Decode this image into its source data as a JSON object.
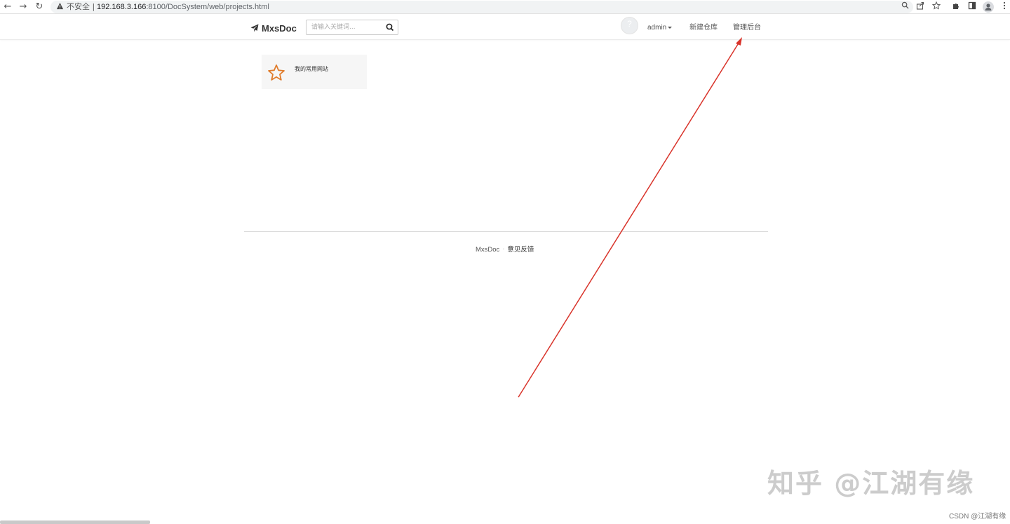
{
  "browser": {
    "back_glyph": "←",
    "forward_glyph": "→",
    "reload_glyph": "↻",
    "security_label": "不安全",
    "separator": "|",
    "url_host": "192.168.3.166",
    "url_rest": ":8100/DocSystem/web/projects.html",
    "icons": [
      "zoom-icon",
      "share-icon",
      "bookmark-star-icon",
      "extensions-icon",
      "side-panel-icon",
      "profile-icon",
      "more-menu-icon"
    ]
  },
  "header": {
    "brand_name": "MxsDoc",
    "search_placeholder": "请输入关键词...",
    "avatar_glyph": "?",
    "user_label": "admin",
    "nav": {
      "new_repo": "新建仓库",
      "admin_console": "管理后台"
    }
  },
  "main": {
    "projects": [
      {
        "title": "我的常用网站"
      }
    ]
  },
  "footer": {
    "brand": "MxsDoc",
    "dot": "·",
    "feedback": "意见反馈"
  },
  "watermark": {
    "text": "知乎 @江湖有缘",
    "csdn": "CSDN @江湖有缘"
  },
  "colors": {
    "star": "#e07b2a",
    "arrow": "#d9342b"
  }
}
